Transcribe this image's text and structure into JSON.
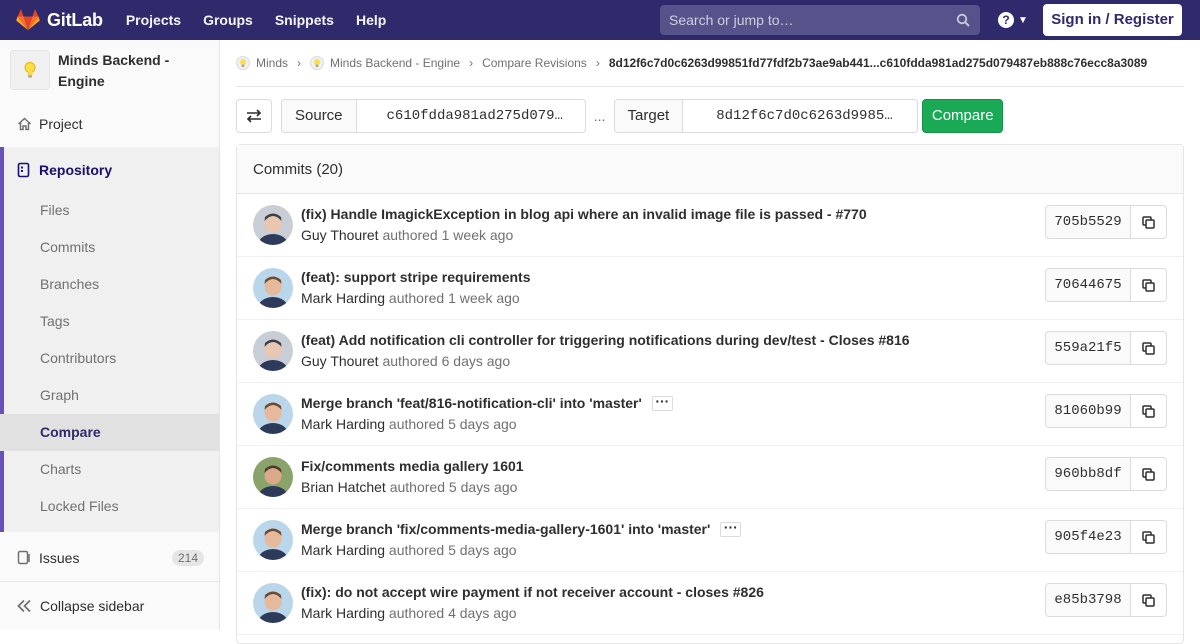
{
  "navbar": {
    "logo_text": "GitLab",
    "links": [
      "Projects",
      "Groups",
      "Snippets",
      "Help"
    ],
    "search_placeholder": "Search or jump to…",
    "signin_label": "Sign in / Register",
    "help_glyph": "?"
  },
  "sidebar": {
    "project_name": "Minds Backend - Engine",
    "project_label": "Project",
    "repository_label": "Repository",
    "repo_items": [
      "Files",
      "Commits",
      "Branches",
      "Tags",
      "Contributors",
      "Graph",
      "Compare",
      "Charts",
      "Locked Files"
    ],
    "active_item": "Compare",
    "issues_label": "Issues",
    "issues_count": "214",
    "collapse_label": "Collapse sidebar"
  },
  "breadcrumb": {
    "items": [
      "Minds",
      "Minds Backend - Engine",
      "Compare Revisions"
    ],
    "current": "8d12f6c7d0c6263d99851fd77fdf2b73ae9ab441...c610fdda981ad275d079487eb888c76ecc8a3089"
  },
  "compare": {
    "source_label": "Source",
    "source_value": "c610fdda981ad275d079…",
    "dots": "...",
    "target_label": "Target",
    "target_value": "8d12f6c7d0c6263d9985…",
    "button_label": "Compare"
  },
  "commits": {
    "header": "Commits (20)",
    "authored_word": "authored",
    "items": [
      {
        "title": "(fix) Handle ImagickException in blog api where an invalid image file is passed - #770",
        "author": "Guy Thouret",
        "time": "1 week ago",
        "sha": "705b5529",
        "ellipsis": false
      },
      {
        "title": "(feat): support stripe requirements",
        "author": "Mark Harding",
        "time": "1 week ago",
        "sha": "70644675",
        "ellipsis": false
      },
      {
        "title": "(feat) Add notification cli controller for triggering notifications during dev/test - Closes #816",
        "author": "Guy Thouret",
        "time": "6 days ago",
        "sha": "559a21f5",
        "ellipsis": false
      },
      {
        "title": "Merge branch 'feat/816-notification-cli' into 'master'",
        "author": "Mark Harding",
        "time": "5 days ago",
        "sha": "81060b99",
        "ellipsis": true
      },
      {
        "title": "Fix/comments media gallery 1601",
        "author": "Brian Hatchet",
        "time": "5 days ago",
        "sha": "960bb8df",
        "ellipsis": false
      },
      {
        "title": "Merge branch 'fix/comments-media-gallery-1601' into 'master'",
        "author": "Mark Harding",
        "time": "5 days ago",
        "sha": "905f4e23",
        "ellipsis": true
      },
      {
        "title": "(fix): do not accept wire payment if not receiver account - closes #826",
        "author": "Mark Harding",
        "time": "4 days ago",
        "sha": "e85b3798",
        "ellipsis": false
      }
    ]
  },
  "colors": {
    "navbar_bg": "#2f2a6b",
    "accent_purple": "#6b4fbb",
    "compare_green": "#1aaa55"
  }
}
